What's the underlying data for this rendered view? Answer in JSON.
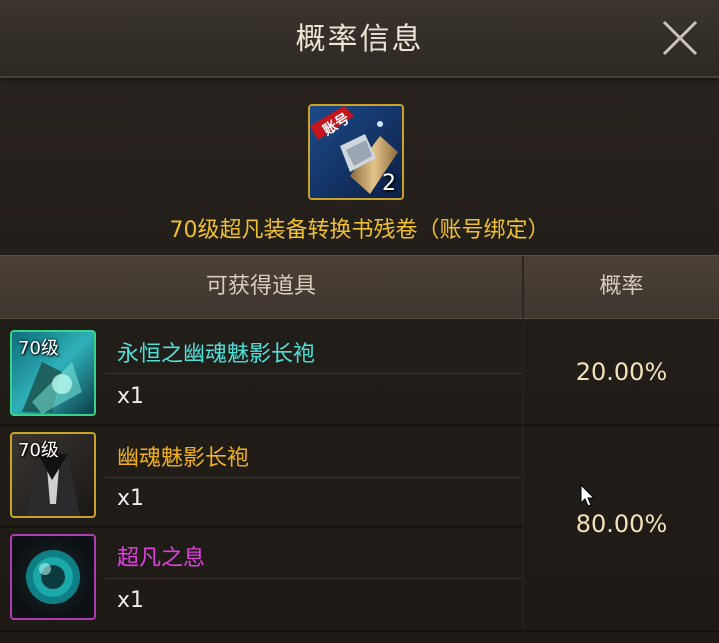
{
  "dialog": {
    "title": "概率信息",
    "close_icon": "close-icon"
  },
  "reward_item": {
    "icon": "account-tag-scroll-icon",
    "tag_text": "账号",
    "count": "2",
    "name": "70级超凡装备转换书残卷（账号绑定）",
    "name_color": "#f0c030"
  },
  "table": {
    "header_items": "可获得道具",
    "header_probability": "概率",
    "rows": [
      {
        "level": "70级",
        "name": "永恒之幽魂魅影长袍",
        "name_color": "#4fe0d8",
        "qty": "x1",
        "frame_color": "#35d68a",
        "icon": "teal-robe-icon"
      },
      {
        "level": "70级",
        "name": "幽魂魅影长袍",
        "name_color": "#f0b020",
        "qty": "x1",
        "frame_color": "#c9a227",
        "icon": "dark-robe-icon"
      },
      {
        "level": "",
        "name": "超凡之息",
        "name_color": "#e040e0",
        "qty": "x1",
        "frame_color": "#b03bb0",
        "icon": "teal-orb-icon"
      }
    ],
    "probabilities": [
      "20.00%",
      "80.00%"
    ]
  }
}
